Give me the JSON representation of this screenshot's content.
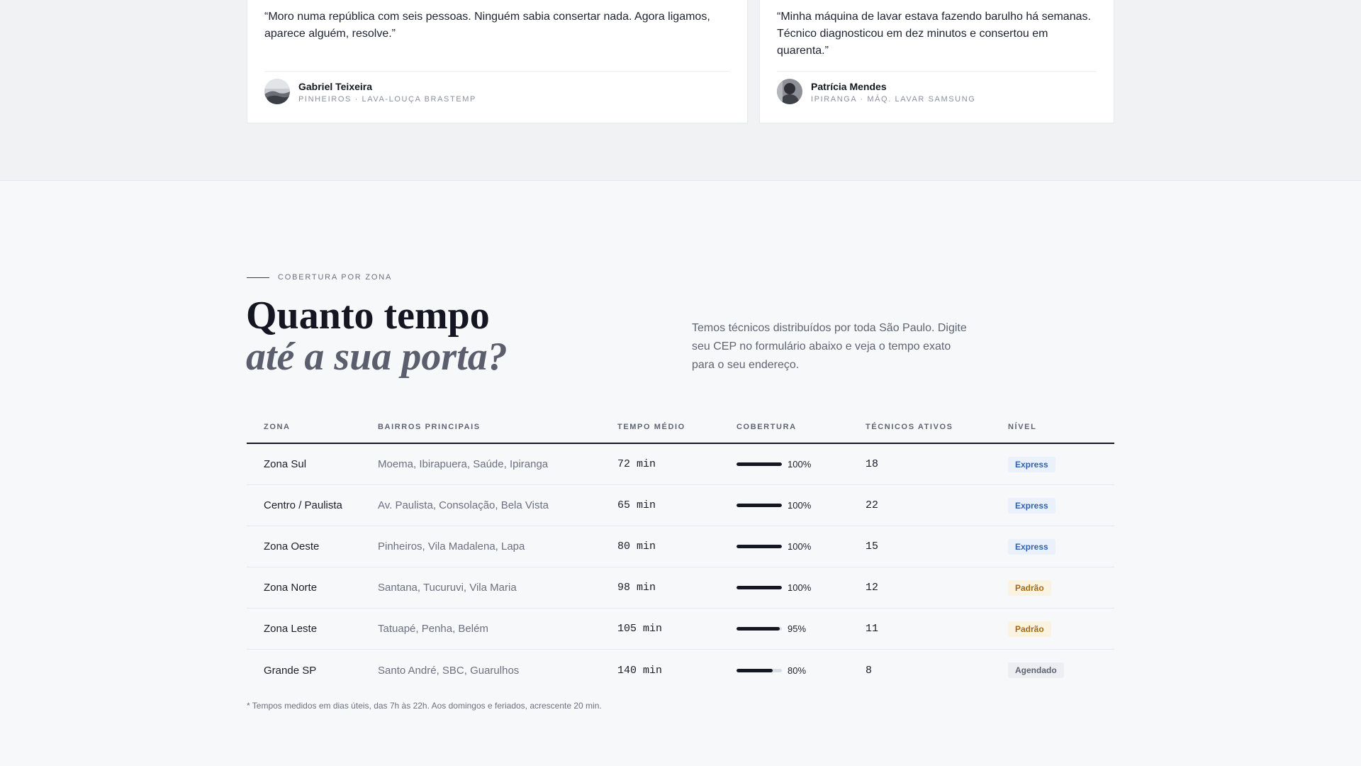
{
  "testimonials": [
    {
      "quote": "“Moro numa república com seis pessoas. Ninguém sabia consertar nada. Agora ligamos, aparece alguém, resolve.”",
      "name": "Gabriel Teixeira",
      "meta": "Pinheiros · Lava-louça Brastemp"
    },
    {
      "quote": "“Minha máquina de lavar estava fazendo barulho há semanas. Técnico diagnosticou em dez minutos e consertou em quarenta.”",
      "name": "Patrícia Mendes",
      "meta": "Ipiranga · Máq. lavar Samsung"
    }
  ],
  "coverage": {
    "eyebrow": "Cobertura por zona",
    "title_line1": "Quanto tempo",
    "title_line2": "até a sua porta?",
    "intro": "Temos técnicos distribuídos por toda São Paulo. Digite seu CEP no formulário abaixo e veja o tempo exato para o seu endereço.",
    "columns": [
      "Zona",
      "Bairros principais",
      "Tempo médio",
      "Cobertura",
      "Técnicos ativos",
      "Nível"
    ],
    "rows": [
      {
        "zona": "Zona Sul",
        "bairros": "Moema, Ibirapuera, Saúde, Ipiranga",
        "tempo": "72 min",
        "cobertura": "100%",
        "coverage_fraction": 1.0,
        "tecnicos": "18",
        "nivel": "Express",
        "nivel_type": "express"
      },
      {
        "zona": "Centro / Paulista",
        "bairros": "Av. Paulista, Consolação, Bela Vista",
        "tempo": "65 min",
        "cobertura": "100%",
        "coverage_fraction": 1.0,
        "tecnicos": "22",
        "nivel": "Express",
        "nivel_type": "express"
      },
      {
        "zona": "Zona Oeste",
        "bairros": "Pinheiros, Vila Madalena, Lapa",
        "tempo": "80 min",
        "cobertura": "100%",
        "coverage_fraction": 1.0,
        "tecnicos": "15",
        "nivel": "Express",
        "nivel_type": "express"
      },
      {
        "zona": "Zona Norte",
        "bairros": "Santana, Tucuruvi, Vila Maria",
        "tempo": "98 min",
        "cobertura": "100%",
        "coverage_fraction": 1.0,
        "tecnicos": "12",
        "nivel": "Padrão",
        "nivel_type": "padrao"
      },
      {
        "zona": "Zona Leste",
        "bairros": "Tatuapé, Penha, Belém",
        "tempo": "105 min",
        "cobertura": "95%",
        "coverage_fraction": 0.95,
        "tecnicos": "11",
        "nivel": "Padrão",
        "nivel_type": "padrao"
      },
      {
        "zona": "Grande SP",
        "bairros": "Santo André, SBC, Guarulhos",
        "tempo": "140 min",
        "cobertura": "80%",
        "coverage_fraction": 0.8,
        "tecnicos": "8",
        "nivel": "Agendado",
        "nivel_type": "agendado"
      }
    ],
    "footnote": "* Tempos medidos em dias úteis, das 7h às 22h. Aos domingos e feriados, acrescente 20 min."
  }
}
